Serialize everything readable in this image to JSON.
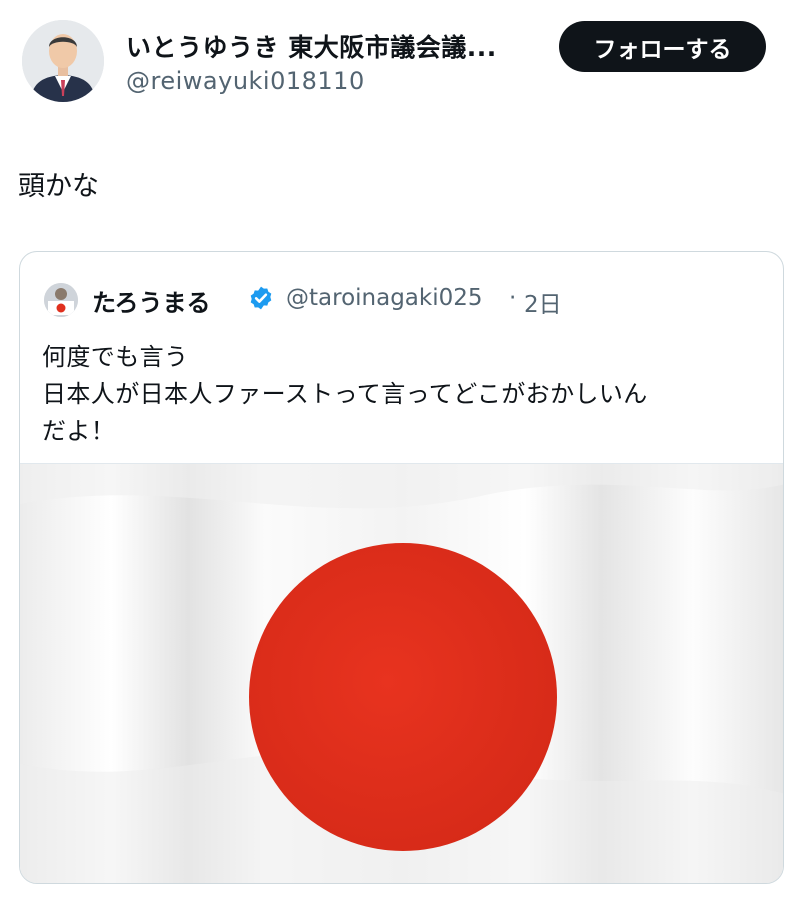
{
  "author": {
    "display_name": "いとうゆうき 東大阪市議会議...",
    "handle": "@reiwayuki018110",
    "follow_label": "フォローする"
  },
  "tweet": {
    "text": "頭かな"
  },
  "quoted": {
    "name": "たろうまる",
    "handle": "@taroinagaki025",
    "separator": "·",
    "time": "2日",
    "lines": [
      "何度でも言う",
      "日本人が日本人ファーストって言ってどこがおかしいん",
      "だよ！"
    ]
  },
  "colors": {
    "follow_button_bg": "#0f1419",
    "verified_badge": "#1d9bf0",
    "flag_red": "#e0301e",
    "secondary_text": "#536471"
  },
  "icons": {
    "verified": "verified-badge-icon"
  }
}
